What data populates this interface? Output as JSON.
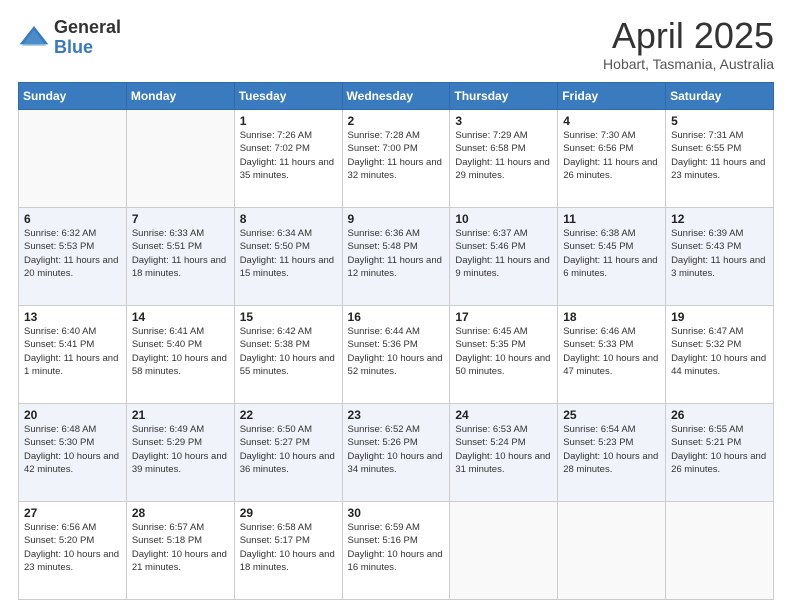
{
  "logo": {
    "general": "General",
    "blue": "Blue"
  },
  "header": {
    "month": "April 2025",
    "location": "Hobart, Tasmania, Australia"
  },
  "weekdays": [
    "Sunday",
    "Monday",
    "Tuesday",
    "Wednesday",
    "Thursday",
    "Friday",
    "Saturday"
  ],
  "weeks": [
    [
      {
        "day": "",
        "sunrise": "",
        "sunset": "",
        "daylight": ""
      },
      {
        "day": "",
        "sunrise": "",
        "sunset": "",
        "daylight": ""
      },
      {
        "day": "1",
        "sunrise": "Sunrise: 7:26 AM",
        "sunset": "Sunset: 7:02 PM",
        "daylight": "Daylight: 11 hours and 35 minutes."
      },
      {
        "day": "2",
        "sunrise": "Sunrise: 7:28 AM",
        "sunset": "Sunset: 7:00 PM",
        "daylight": "Daylight: 11 hours and 32 minutes."
      },
      {
        "day": "3",
        "sunrise": "Sunrise: 7:29 AM",
        "sunset": "Sunset: 6:58 PM",
        "daylight": "Daylight: 11 hours and 29 minutes."
      },
      {
        "day": "4",
        "sunrise": "Sunrise: 7:30 AM",
        "sunset": "Sunset: 6:56 PM",
        "daylight": "Daylight: 11 hours and 26 minutes."
      },
      {
        "day": "5",
        "sunrise": "Sunrise: 7:31 AM",
        "sunset": "Sunset: 6:55 PM",
        "daylight": "Daylight: 11 hours and 23 minutes."
      }
    ],
    [
      {
        "day": "6",
        "sunrise": "Sunrise: 6:32 AM",
        "sunset": "Sunset: 5:53 PM",
        "daylight": "Daylight: 11 hours and 20 minutes."
      },
      {
        "day": "7",
        "sunrise": "Sunrise: 6:33 AM",
        "sunset": "Sunset: 5:51 PM",
        "daylight": "Daylight: 11 hours and 18 minutes."
      },
      {
        "day": "8",
        "sunrise": "Sunrise: 6:34 AM",
        "sunset": "Sunset: 5:50 PM",
        "daylight": "Daylight: 11 hours and 15 minutes."
      },
      {
        "day": "9",
        "sunrise": "Sunrise: 6:36 AM",
        "sunset": "Sunset: 5:48 PM",
        "daylight": "Daylight: 11 hours and 12 minutes."
      },
      {
        "day": "10",
        "sunrise": "Sunrise: 6:37 AM",
        "sunset": "Sunset: 5:46 PM",
        "daylight": "Daylight: 11 hours and 9 minutes."
      },
      {
        "day": "11",
        "sunrise": "Sunrise: 6:38 AM",
        "sunset": "Sunset: 5:45 PM",
        "daylight": "Daylight: 11 hours and 6 minutes."
      },
      {
        "day": "12",
        "sunrise": "Sunrise: 6:39 AM",
        "sunset": "Sunset: 5:43 PM",
        "daylight": "Daylight: 11 hours and 3 minutes."
      }
    ],
    [
      {
        "day": "13",
        "sunrise": "Sunrise: 6:40 AM",
        "sunset": "Sunset: 5:41 PM",
        "daylight": "Daylight: 11 hours and 1 minute."
      },
      {
        "day": "14",
        "sunrise": "Sunrise: 6:41 AM",
        "sunset": "Sunset: 5:40 PM",
        "daylight": "Daylight: 10 hours and 58 minutes."
      },
      {
        "day": "15",
        "sunrise": "Sunrise: 6:42 AM",
        "sunset": "Sunset: 5:38 PM",
        "daylight": "Daylight: 10 hours and 55 minutes."
      },
      {
        "day": "16",
        "sunrise": "Sunrise: 6:44 AM",
        "sunset": "Sunset: 5:36 PM",
        "daylight": "Daylight: 10 hours and 52 minutes."
      },
      {
        "day": "17",
        "sunrise": "Sunrise: 6:45 AM",
        "sunset": "Sunset: 5:35 PM",
        "daylight": "Daylight: 10 hours and 50 minutes."
      },
      {
        "day": "18",
        "sunrise": "Sunrise: 6:46 AM",
        "sunset": "Sunset: 5:33 PM",
        "daylight": "Daylight: 10 hours and 47 minutes."
      },
      {
        "day": "19",
        "sunrise": "Sunrise: 6:47 AM",
        "sunset": "Sunset: 5:32 PM",
        "daylight": "Daylight: 10 hours and 44 minutes."
      }
    ],
    [
      {
        "day": "20",
        "sunrise": "Sunrise: 6:48 AM",
        "sunset": "Sunset: 5:30 PM",
        "daylight": "Daylight: 10 hours and 42 minutes."
      },
      {
        "day": "21",
        "sunrise": "Sunrise: 6:49 AM",
        "sunset": "Sunset: 5:29 PM",
        "daylight": "Daylight: 10 hours and 39 minutes."
      },
      {
        "day": "22",
        "sunrise": "Sunrise: 6:50 AM",
        "sunset": "Sunset: 5:27 PM",
        "daylight": "Daylight: 10 hours and 36 minutes."
      },
      {
        "day": "23",
        "sunrise": "Sunrise: 6:52 AM",
        "sunset": "Sunset: 5:26 PM",
        "daylight": "Daylight: 10 hours and 34 minutes."
      },
      {
        "day": "24",
        "sunrise": "Sunrise: 6:53 AM",
        "sunset": "Sunset: 5:24 PM",
        "daylight": "Daylight: 10 hours and 31 minutes."
      },
      {
        "day": "25",
        "sunrise": "Sunrise: 6:54 AM",
        "sunset": "Sunset: 5:23 PM",
        "daylight": "Daylight: 10 hours and 28 minutes."
      },
      {
        "day": "26",
        "sunrise": "Sunrise: 6:55 AM",
        "sunset": "Sunset: 5:21 PM",
        "daylight": "Daylight: 10 hours and 26 minutes."
      }
    ],
    [
      {
        "day": "27",
        "sunrise": "Sunrise: 6:56 AM",
        "sunset": "Sunset: 5:20 PM",
        "daylight": "Daylight: 10 hours and 23 minutes."
      },
      {
        "day": "28",
        "sunrise": "Sunrise: 6:57 AM",
        "sunset": "Sunset: 5:18 PM",
        "daylight": "Daylight: 10 hours and 21 minutes."
      },
      {
        "day": "29",
        "sunrise": "Sunrise: 6:58 AM",
        "sunset": "Sunset: 5:17 PM",
        "daylight": "Daylight: 10 hours and 18 minutes."
      },
      {
        "day": "30",
        "sunrise": "Sunrise: 6:59 AM",
        "sunset": "Sunset: 5:16 PM",
        "daylight": "Daylight: 10 hours and 16 minutes."
      },
      {
        "day": "",
        "sunrise": "",
        "sunset": "",
        "daylight": ""
      },
      {
        "day": "",
        "sunrise": "",
        "sunset": "",
        "daylight": ""
      },
      {
        "day": "",
        "sunrise": "",
        "sunset": "",
        "daylight": ""
      }
    ]
  ]
}
